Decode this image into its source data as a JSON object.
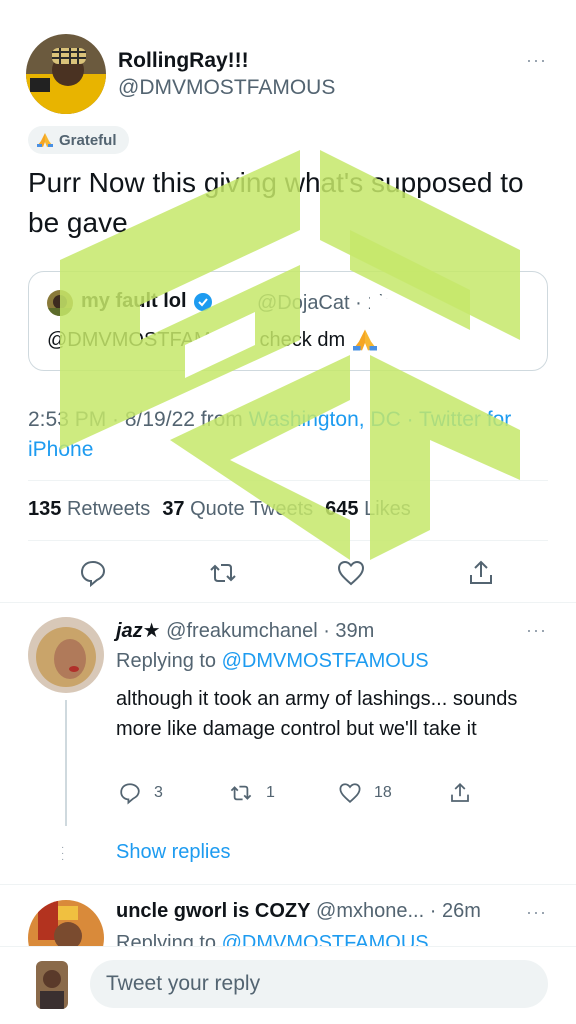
{
  "main_tweet": {
    "display_name": "RollingRay!!!",
    "handle": "@DMVMOSTFAMOUS",
    "more_icon": "ellipsis-icon",
    "badge": "Grateful",
    "text": "Purr Now this giving what's supposed to be gave",
    "quote": {
      "name": "my fault lol",
      "meta": "@DojaCat · 1h",
      "text": "@DMVMOSTFAMOUS check dm"
    },
    "timestamp_time_date": "2:53 PM · 8/19/22",
    "timestamp_from": "from",
    "location": "Washington, DC",
    "client": "· Twitter for iPhone",
    "stats": [
      {
        "count": "135",
        "label": "Retweets"
      },
      {
        "count": "37",
        "label": "Quote Tweets"
      },
      {
        "count": "645",
        "label": "Likes"
      }
    ],
    "actions": [
      "reply-icon",
      "retweet-icon",
      "like-icon",
      "share-icon"
    ]
  },
  "replies": [
    {
      "display_name": "jaz★",
      "handle_time": "@freakumchanel · 39m",
      "replying_to_label": "Replying to",
      "replying_to": "@DMVMOSTFAMOUS",
      "text": "although it took an army of lashings... sounds more like damage control but we'll take it",
      "reply_count": "3",
      "retweet_count": "1",
      "like_count": "18",
      "show_replies": "Show replies"
    },
    {
      "display_name": "uncle gworl is COZY",
      "handle_time": "@mxhone... · 26m",
      "replying_to_label": "Replying to",
      "replying_to": "@DMVMOSTFAMOUS"
    }
  ],
  "compose": {
    "placeholder": "Tweet your reply"
  },
  "colors": {
    "accent": "#1d9bf0",
    "watermark": "#c6e86a",
    "text": "#0f1419",
    "muted": "#536471"
  }
}
